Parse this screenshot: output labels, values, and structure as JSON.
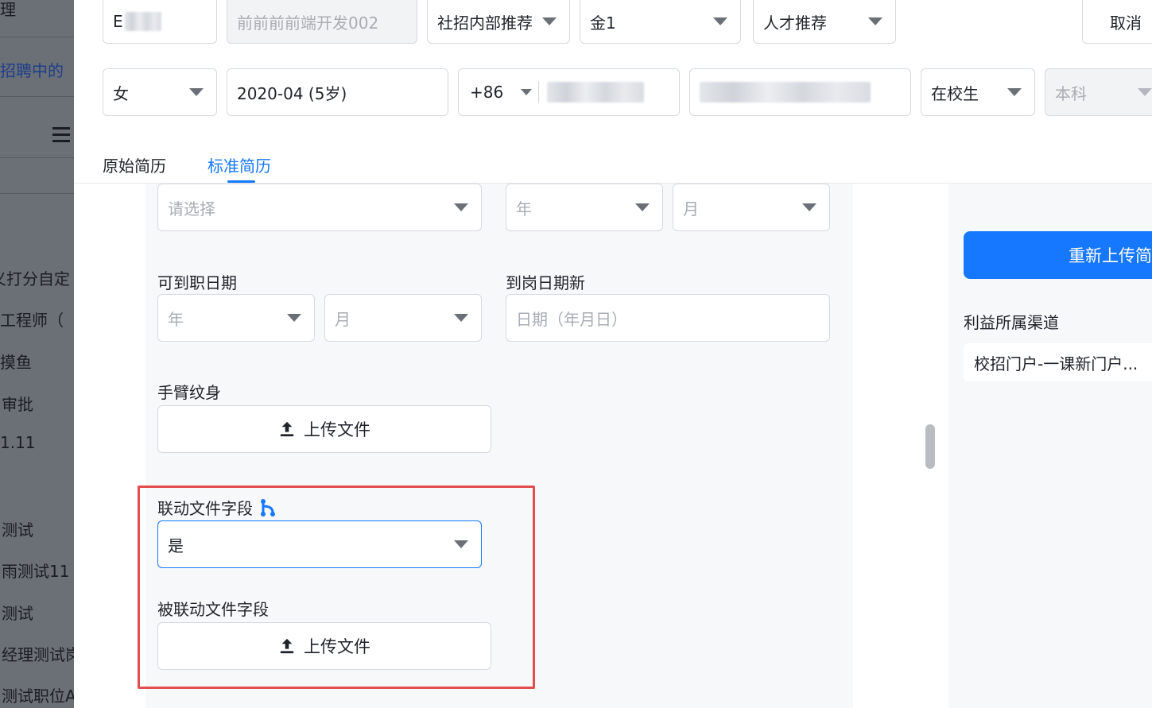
{
  "background_menu": {
    "items": [
      "理",
      "招聘中的",
      "义打分自定",
      "工程师（",
      "摸鱼",
      "审批",
      "1.11",
      "测试",
      "雨测试11",
      "测试",
      "经理测试岗",
      "测试职位A"
    ]
  },
  "header_row1": {
    "name_value": "E",
    "position_value": "前前前前端开发002",
    "channel_value": "社招内部推荐",
    "level_value": "金1",
    "source_value": "人才推荐",
    "cancel_label": "取消"
  },
  "header_row2": {
    "gender_value": "女",
    "birth_value": "2020-04 (5岁)",
    "country_code": "+86",
    "status_value": "在校生",
    "degree_value": "本科"
  },
  "tabs": {
    "original": "原始简历",
    "standard": "标准简历"
  },
  "form": {
    "select_placeholder": "请选择",
    "year_placeholder": "年",
    "month_placeholder": "月",
    "available_date_label": "可到职日期",
    "arrival_date_label": "到岗日期新",
    "date_placeholder": "日期（年月日）",
    "tattoo_label": "手臂纹身",
    "upload_label": "上传文件",
    "linked_field_label": "联动文件字段",
    "linked_field_value": "是",
    "linked_target_label": "被联动文件字段"
  },
  "sidebar_right": {
    "reupload_label": "重新上传简历",
    "channel_label": "利益所属渠道",
    "channel_value": "校招门户-一课新门户..."
  },
  "colors": {
    "accent": "#1677ff",
    "highlight_border": "#e34d4d"
  }
}
